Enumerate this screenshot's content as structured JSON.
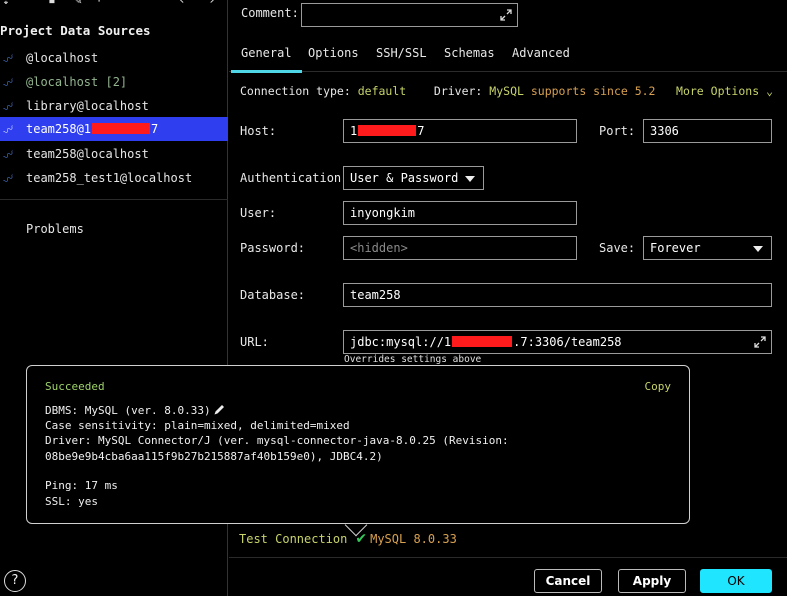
{
  "left_panel": {
    "title": "Project Data Sources",
    "items": [
      {
        "label": "@localhost",
        "style": "normal"
      },
      {
        "label": "@localhost [2]",
        "style": "dim"
      },
      {
        "label": "library@localhost",
        "style": "normal"
      },
      {
        "label_prefix": "team258@1",
        "label_suffix": "7",
        "style": "selected",
        "redacted": true
      },
      {
        "label": "team258@localhost",
        "style": "normal"
      },
      {
        "label": "team258_test1@localhost",
        "style": "normal"
      }
    ],
    "problems_label": "Problems",
    "help_label": "?"
  },
  "form": {
    "comment_label": "Comment:",
    "comment_value": "",
    "tabs": [
      {
        "label": "General",
        "active": true
      },
      {
        "label": "Options",
        "active": false
      },
      {
        "label": "SSH/SSL",
        "active": false
      },
      {
        "label": "Schemas",
        "active": false
      },
      {
        "label": "Advanced",
        "active": false
      }
    ],
    "connection_type_label": "Connection type:",
    "connection_type_value": "default",
    "driver_label": "Driver:",
    "driver_value": "MySQL",
    "driver_note": "supports since 5.2",
    "more_options_label": "More Options",
    "host_label": "Host:",
    "host_prefix": "1",
    "host_suffix": "7",
    "port_label": "Port:",
    "port_value": "3306",
    "auth_label": "Authentication:",
    "auth_value": "User & Password",
    "user_label": "User:",
    "user_value": "inyongkim",
    "password_label": "Password:",
    "password_placeholder": "<hidden>",
    "save_label": "Save:",
    "save_value": "Forever",
    "database_label": "Database:",
    "database_value": "team258",
    "url_label": "URL:",
    "url_prefix": "jdbc:mysql://1",
    "url_suffix": ".7:3306/team258",
    "url_hint": "Overrides settings above",
    "test_connection_label": "Test Connection",
    "test_result": "MySQL 8.0.33"
  },
  "popup": {
    "status": "Succeeded",
    "copy_label": "Copy",
    "lines": [
      "DBMS: MySQL (ver. 8.0.33)",
      "Case sensitivity: plain=mixed, delimited=mixed",
      "Driver: MySQL Connector/J (ver. mysql-connector-java-8.0.25 (Revision:",
      "08be9e9b4cba6aa115f9b27b215887af40b159e0), JDBC4.2)",
      "Ping: 17 ms",
      "SSL: yes"
    ]
  },
  "buttons": {
    "cancel": "Cancel",
    "apply": "Apply",
    "ok": "OK"
  },
  "colors": {
    "accent_cyan": "#1fe5ff",
    "selection_blue": "#2f3ff0",
    "success_green": "#34c85a",
    "link_yellow": "#c8d36a",
    "orange": "#d8a050",
    "redaction": "#ff1b1b"
  }
}
